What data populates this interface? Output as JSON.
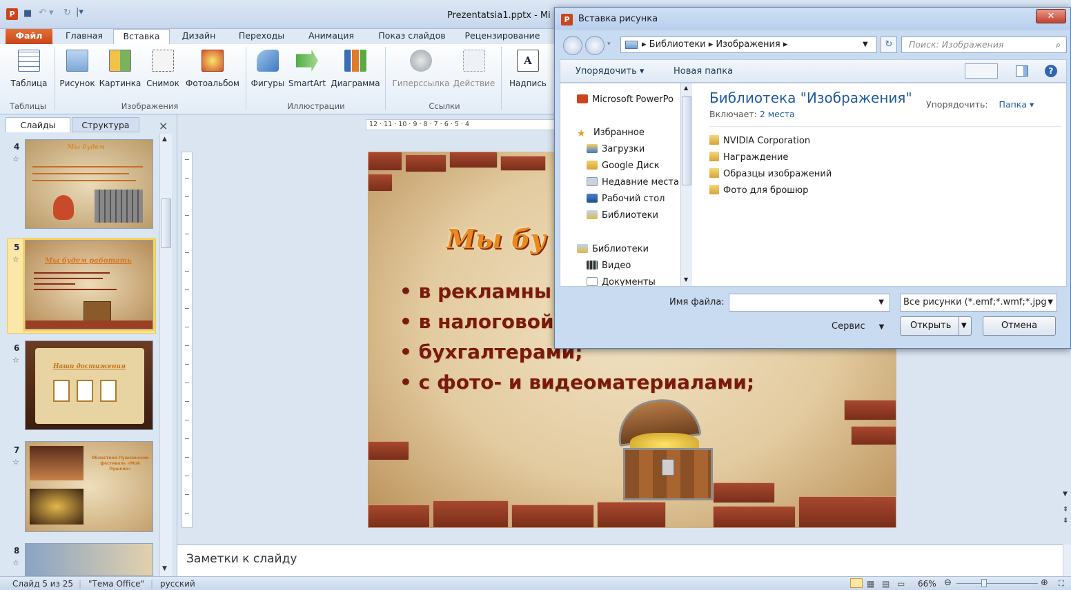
{
  "app": {
    "doc_title": "Prezentatsia1.pptx - Mi",
    "logo_letter": "P"
  },
  "tabs": [
    "Файл",
    "Главная",
    "Вставка",
    "Дизайн",
    "Переходы",
    "Анимация",
    "Показ слайдов",
    "Рецензирование"
  ],
  "ribbon": {
    "buttons": [
      "Таблица",
      "Рисунок",
      "Картинка",
      "Снимок",
      "Фотоальбом",
      "Фигуры",
      "SmartArt",
      "Диаграмма",
      "Гиперссылка",
      "Действие",
      "Надпись"
    ],
    "groups": [
      "Таблицы",
      "Изображения",
      "Иллюстрации",
      "Ссылки"
    ]
  },
  "left_panel": {
    "tabs": [
      "Слайды",
      "Структура"
    ],
    "close": "×",
    "slides": [
      {
        "num": "4",
        "title": "Мы будем"
      },
      {
        "num": "5",
        "title": "Мы будем работать"
      },
      {
        "num": "6",
        "title": "Наши достижения"
      },
      {
        "num": "7",
        "title": "Областной Пушкинский фестиваль «Мой Пушкин»"
      },
      {
        "num": "8",
        "title": ""
      }
    ]
  },
  "ruler": {
    "h": "12 · 11 · 10 · 9 · 8 · 7 · 6 · 5 · 4"
  },
  "slide": {
    "title": "Мы бу",
    "bullets": [
      "в рекламны",
      "в налоговой",
      "бухгалтерами;",
      "с фото- и видеоматериалами;"
    ]
  },
  "notes": {
    "placeholder": "Заметки к слайду"
  },
  "status": {
    "slide_info": "Слайд 5 из 25",
    "theme": "\"Тема Office\"",
    "lang": "русский",
    "zoom": "66%"
  },
  "dialog": {
    "title": "Вставка рисунка",
    "breadcrumb": "▸ Библиотеки ▸ Изображения ▸",
    "search_placeholder": "Поиск: Изображения",
    "toolbar": {
      "arrange": "Упорядочить ▾",
      "new_folder": "Новая папка"
    },
    "nav_items": [
      "Microsoft PowerPo",
      "Избранное",
      "Загрузки",
      "Google Диск",
      "Недавние места",
      "Рабочий стол",
      "Библиотеки",
      "Библиотеки",
      "Видео",
      "Документы"
    ],
    "library_title": "Библиотека \"Изображения\"",
    "library_includes_label": "Включает:",
    "library_includes_link": "2 места",
    "arrange_label": "Упорядочить:",
    "arrange_value": "Папка ▾",
    "folders": [
      "NVIDIA Corporation",
      "Награждение",
      "Образцы изображений",
      "Фото для брошюр"
    ],
    "filename_label": "Имя файла:",
    "filename_value": "",
    "filetype": "Все рисунки (*.emf;*.wmf;*.jpg",
    "service": "Сервис",
    "open": "Открыть",
    "cancel": "Отмена"
  },
  "colors": {
    "accent": "#c8471c",
    "link": "#1f5aa0",
    "slide_text": "#7a1a0e",
    "title_orange": "#e88a1f"
  }
}
